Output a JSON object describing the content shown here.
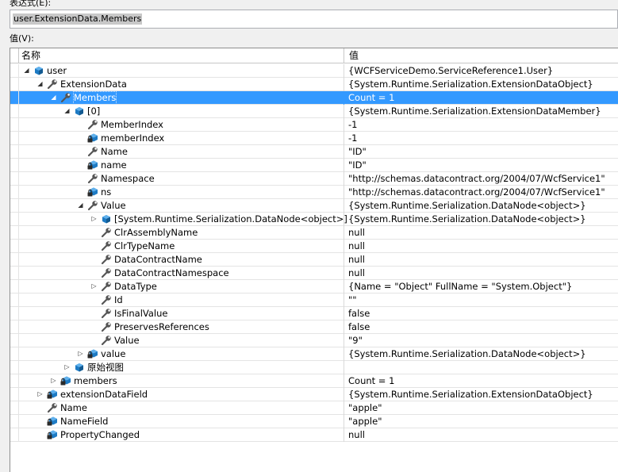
{
  "expression": {
    "label": "表达式(E):",
    "value": "user.ExtensionData.Members"
  },
  "value_label": "值(V):",
  "grid": {
    "header": {
      "name": "名称",
      "value": "值"
    },
    "rows": [
      {
        "name": "user",
        "value": "{WCFServiceDemo.ServiceReference1.User}",
        "level": 0,
        "expander": "expanded",
        "icon": "field-icon"
      },
      {
        "name": "ExtensionData",
        "value": "{System.Runtime.Serialization.ExtensionDataObject}",
        "level": 1,
        "expander": "expanded",
        "icon": "property-icon"
      },
      {
        "name": "Members",
        "value": "Count = 1",
        "level": 2,
        "expander": "expanded",
        "icon": "property-icon",
        "selected": true
      },
      {
        "name": "[0]",
        "value": "{System.Runtime.Serialization.ExtensionDataMember}",
        "level": 3,
        "expander": "expanded",
        "icon": "field-icon"
      },
      {
        "name": "MemberIndex",
        "value": "-1",
        "level": 4,
        "expander": "none",
        "icon": "property-icon"
      },
      {
        "name": "memberIndex",
        "value": "-1",
        "level": 4,
        "expander": "none",
        "icon": "private-field-icon"
      },
      {
        "name": "Name",
        "value": "\"ID\"",
        "level": 4,
        "expander": "none",
        "icon": "property-icon"
      },
      {
        "name": "name",
        "value": "\"ID\"",
        "level": 4,
        "expander": "none",
        "icon": "private-field-icon"
      },
      {
        "name": "Namespace",
        "value": "\"http://schemas.datacontract.org/2004/07/WcfService1\"",
        "level": 4,
        "expander": "none",
        "icon": "property-icon"
      },
      {
        "name": "ns",
        "value": "\"http://schemas.datacontract.org/2004/07/WcfService1\"",
        "level": 4,
        "expander": "none",
        "icon": "private-field-icon"
      },
      {
        "name": "Value",
        "value": "{System.Runtime.Serialization.DataNode<object>}",
        "level": 4,
        "expander": "expanded",
        "icon": "property-icon"
      },
      {
        "name": "[System.Runtime.Serialization.DataNode<object>]",
        "value": "{System.Runtime.Serialization.DataNode<object>}",
        "level": 5,
        "expander": "collapsed",
        "icon": "field-icon"
      },
      {
        "name": "ClrAssemblyName",
        "value": "null",
        "level": 5,
        "expander": "none",
        "icon": "property-icon"
      },
      {
        "name": "ClrTypeName",
        "value": "null",
        "level": 5,
        "expander": "none",
        "icon": "property-icon"
      },
      {
        "name": "DataContractName",
        "value": "null",
        "level": 5,
        "expander": "none",
        "icon": "property-icon"
      },
      {
        "name": "DataContractNamespace",
        "value": "null",
        "level": 5,
        "expander": "none",
        "icon": "property-icon"
      },
      {
        "name": "DataType",
        "value": "{Name = \"Object\" FullName = \"System.Object\"}",
        "level": 5,
        "expander": "collapsed",
        "icon": "property-icon"
      },
      {
        "name": "Id",
        "value": "\"\"",
        "level": 5,
        "expander": "none",
        "icon": "property-icon"
      },
      {
        "name": "IsFinalValue",
        "value": "false",
        "level": 5,
        "expander": "none",
        "icon": "property-icon"
      },
      {
        "name": "PreservesReferences",
        "value": "false",
        "level": 5,
        "expander": "none",
        "icon": "property-icon"
      },
      {
        "name": "Value",
        "value": "\"9\"",
        "level": 5,
        "expander": "none",
        "icon": "property-icon"
      },
      {
        "name": "value",
        "value": "{System.Runtime.Serialization.DataNode<object>}",
        "level": 4,
        "expander": "collapsed",
        "icon": "private-field-icon"
      },
      {
        "name": "原始视图",
        "value": "",
        "level": 3,
        "expander": "collapsed",
        "icon": "field-icon"
      },
      {
        "name": "members",
        "value": "Count = 1",
        "level": 2,
        "expander": "collapsed",
        "icon": "private-field-icon"
      },
      {
        "name": "extensionDataField",
        "value": "{System.Runtime.Serialization.ExtensionDataObject}",
        "level": 1,
        "expander": "collapsed",
        "icon": "private-field-icon"
      },
      {
        "name": "Name",
        "value": "\"apple\"",
        "level": 1,
        "expander": "none",
        "icon": "property-icon"
      },
      {
        "name": "NameField",
        "value": "\"apple\"",
        "level": 1,
        "expander": "none",
        "icon": "private-field-icon"
      },
      {
        "name": "PropertyChanged",
        "value": "null",
        "level": 1,
        "expander": "none",
        "icon": "private-field-icon"
      }
    ]
  },
  "colors": {
    "selection": "#3399ff",
    "field_icon": "#1e7bc4",
    "property_icon": "#555555"
  }
}
